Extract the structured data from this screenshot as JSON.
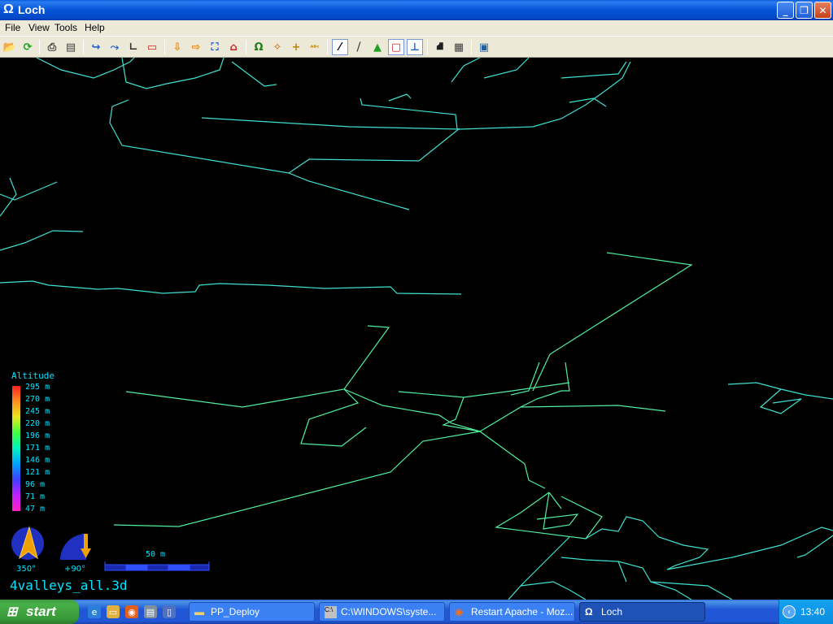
{
  "window": {
    "title": "Loch",
    "icon": "omega-icon"
  },
  "menu": {
    "items": [
      "File",
      "View",
      "Tools",
      "Help"
    ]
  },
  "toolbar": {
    "icons": [
      "open-icon",
      "reload-icon",
      "print-icon",
      "export-icon",
      "rotate-icon",
      "no-rotate-icon",
      "angle-icon",
      "stereo-icon",
      "plan-view-icon",
      "elevation-view-icon",
      "fit-view-icon",
      "home-view-icon",
      "entrance-icon",
      "station-icon",
      "cross-icon",
      "label-icon",
      "centreline-icon",
      "walls-icon",
      "surface-icon",
      "box-icon",
      "scale-icon",
      "camera-icon",
      "notes-icon",
      "fullscreen-icon"
    ]
  },
  "legend": {
    "title": "Altitude",
    "labels": [
      "295 m",
      "270 m",
      "245 m",
      "220 m",
      "196 m",
      "171 m",
      "146 m",
      "121 m",
      "96 m",
      "71 m",
      "47 m"
    ]
  },
  "compass": {
    "label": "350°"
  },
  "tilt": {
    "label": "+90°"
  },
  "scale": {
    "label": "50 m"
  },
  "file": {
    "name": "4valleys_all.3d"
  },
  "colors": {
    "survey_primary": "#40e0d0",
    "survey_secondary": "#50f0a0",
    "legend_text": "#00e5ff",
    "background": "#000000"
  },
  "taskbar": {
    "start_label": "start",
    "tasks": [
      {
        "label": "PP_Deploy",
        "icon": "folder-icon"
      },
      {
        "label": "C:\\WINDOWS\\syste...",
        "icon": "cmd-icon"
      },
      {
        "label": "Restart Apache - Moz...",
        "icon": "firefox-icon"
      },
      {
        "label": "Loch",
        "icon": "omega-icon"
      }
    ],
    "clock": "13:40"
  }
}
